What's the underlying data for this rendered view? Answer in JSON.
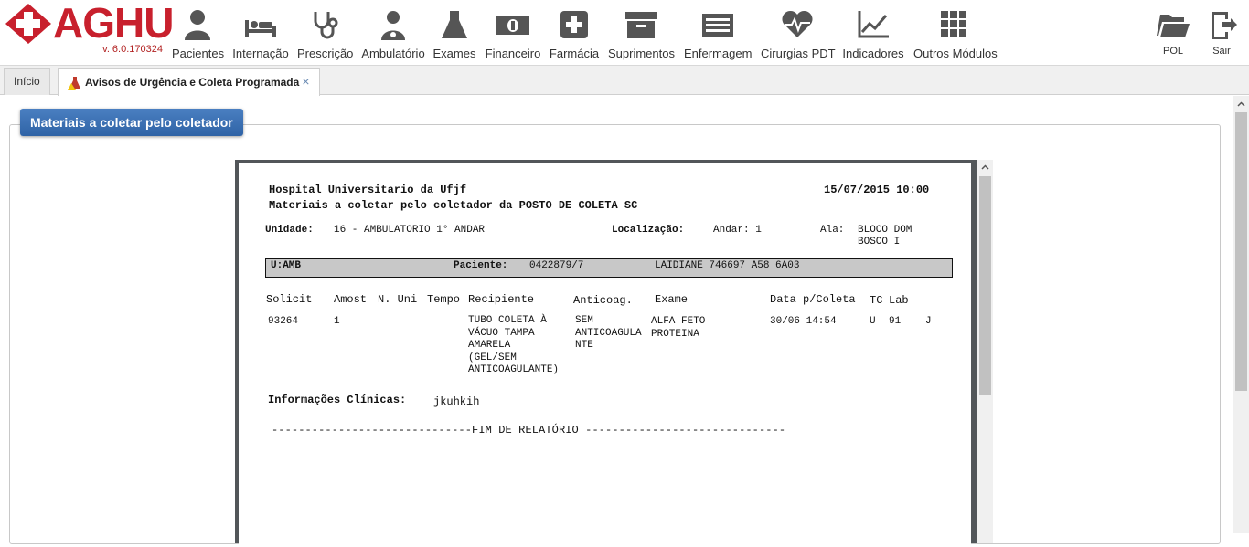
{
  "app": {
    "name": "AGHU",
    "version": "v. 6.0.170324"
  },
  "modules": [
    {
      "label": "Pacientes",
      "icon": "person-icon"
    },
    {
      "label": "Internação",
      "icon": "bed-icon"
    },
    {
      "label": "Prescrição",
      "icon": "stethoscope-icon"
    },
    {
      "label": "Ambulatório",
      "icon": "doctor-icon"
    },
    {
      "label": "Exames",
      "icon": "flask-icon"
    },
    {
      "label": "Financeiro",
      "icon": "money-icon"
    },
    {
      "label": "Farmácia",
      "icon": "plus-box-icon"
    },
    {
      "label": "Suprimentos",
      "icon": "archive-box-icon"
    },
    {
      "label": "Enfermagem",
      "icon": "list-icon"
    },
    {
      "label": "Cirurgias PDT",
      "icon": "heart-pulse-icon"
    },
    {
      "label": "Indicadores",
      "icon": "line-chart-icon"
    },
    {
      "label": "Outros Módulos",
      "icon": "grid-icon"
    }
  ],
  "right_actions": [
    {
      "label": "POL",
      "icon": "folder-open-icon"
    },
    {
      "label": "Sair",
      "icon": "exit-door-icon"
    }
  ],
  "tabs": [
    {
      "label": "Início",
      "active": false
    },
    {
      "label": "Avisos de Urgência e Coleta Programada",
      "active": true,
      "close": "×"
    }
  ],
  "panel": {
    "title": "Materiais a coletar pelo coletador"
  },
  "report": {
    "hospital": "Hospital Universitario da Ufjf",
    "datetime": "15/07/2015 10:00",
    "subtitle": "Materiais a coletar pelo coletador da POSTO DE COLETA SC",
    "unidade_label": "Unidade:",
    "unidade_value": "16 - AMBULATORIO 1° ANDAR",
    "localizacao_label": "Localização:",
    "andar": "Andar: 1",
    "ala_label": "Ala:",
    "ala_value_1": "BLOCO DOM",
    "ala_value_2": "BOSCO I",
    "patient_unit": "U:AMB",
    "paciente_label": "Paciente:",
    "paciente_id": "0422879/7",
    "paciente_name": "LAIDIANE 746697 A58 6A03",
    "columns": {
      "solicit": "Solicit",
      "amost": "Amost",
      "n_uni": "N. Uni",
      "tempo": "Tempo",
      "recipiente": "Recipiente",
      "anticoag": "Anticoag.",
      "exame": "Exame",
      "data_coleta": "Data p/Coleta",
      "tc": "TC",
      "lab": "Lab"
    },
    "row": {
      "solicit": "93264",
      "amost": "1",
      "recipiente": "TUBO COLETA À\nVÁCUO TAMPA\nAMARELA\n(GEL/SEM\nANTICOAGULANTE)",
      "anticoag": "SEM\nANTICOAGULA\nNTE",
      "exame": "ALFA FETO\nPROTEINA",
      "data_coleta": "30/06 14:54",
      "tc": "U",
      "lab": "91",
      "extra": "J"
    },
    "info_label": "Informações Clínicas:",
    "info_value": "jkuhkih",
    "end_line": "------------------------------FIM DE RELATÓRIO ------------------------------"
  },
  "colors": {
    "brand_red": "#c8202d",
    "icon_gray": "#555555",
    "panel_blue": "#3a6fb0"
  }
}
